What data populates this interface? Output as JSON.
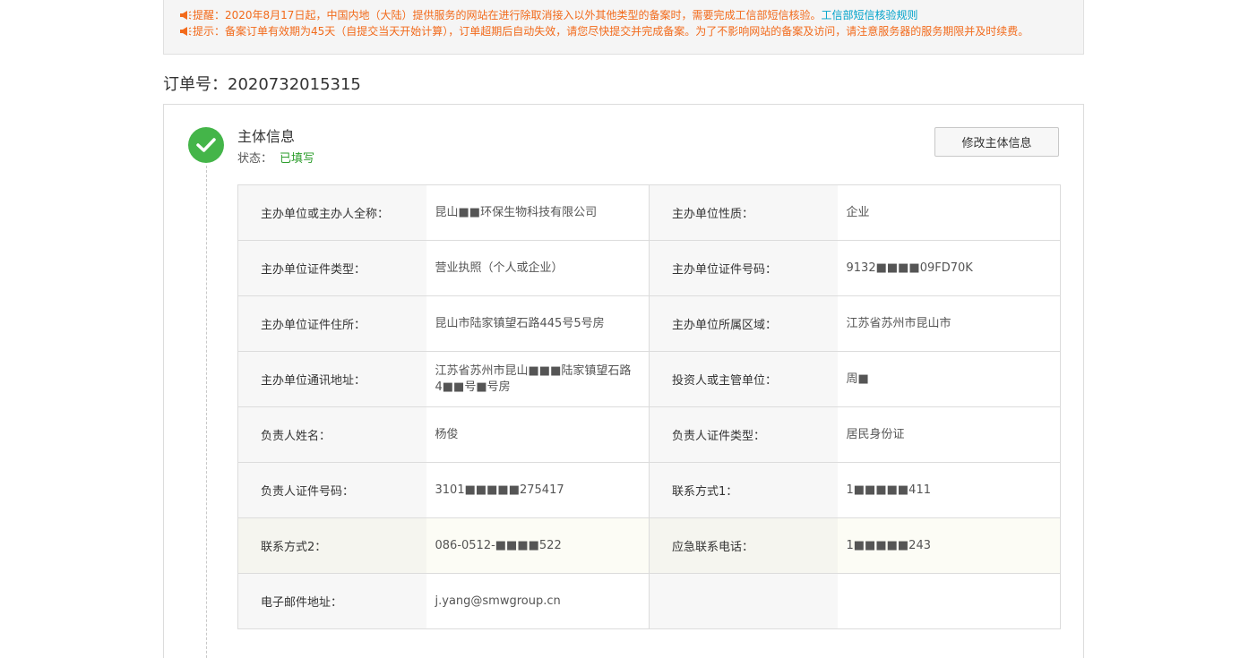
{
  "notice": {
    "line1": "提醒：2020年8月17日起，中国内地（大陆）提供服务的网站在进行除取消接入以外其他类型的备案时，需要完成工信部短信核验。",
    "line1_link": "工信部短信核验规则",
    "line2": "提示：备案订单有效期为45天（自提交当天开始计算），订单超期后自动失效，请您尽快提交并完成备案。为了不影响网站的备案及访问，请注意服务器的服务期限并及时续费。",
    "icon": "megaphone-icon",
    "color": "#f26a1b"
  },
  "order": {
    "label": "订单号：",
    "number": "2020732015315"
  },
  "section": {
    "title": "主体信息",
    "status_label": "状态：",
    "status_value": "已填写",
    "status_color": "#2e9e2e",
    "icon": "check-circle-icon",
    "edit_button": "修改主体信息"
  },
  "rows": [
    {
      "l1": "主办单位或主办人全称：",
      "v1": "昆山■■环保生物科技有限公司",
      "l2": "主办单位性质：",
      "v2": "企业"
    },
    {
      "l1": "主办单位证件类型：",
      "v1": "营业执照（个人或企业）",
      "l2": "主办单位证件号码：",
      "v2": "9132■■■■09FD70K"
    },
    {
      "l1": "主办单位证件住所：",
      "v1": "昆山市陆家镇望石路445号5号房",
      "l2": "主办单位所属区域：",
      "v2": "江苏省苏州市昆山市"
    },
    {
      "l1": "主办单位通讯地址：",
      "v1": "江苏省苏州市昆山■■■陆家镇望石路4■■号■号房",
      "l2": "投资人或主管单位：",
      "v2": "周■"
    },
    {
      "l1": "负责人姓名：",
      "v1": "杨俊",
      "l2": "负责人证件类型：",
      "v2": "居民身份证"
    },
    {
      "l1": "负责人证件号码：",
      "v1": "3101■■■■■275417",
      "l2": "联系方式1：",
      "v2": "1■■■■■411"
    },
    {
      "l1": "联系方式2：",
      "v1": "086-0512-■■■■522",
      "l2": "应急联系电话：",
      "v2": "1■■■■■243"
    },
    {
      "l1": "电子邮件地址：",
      "v1": "j.yang@smwgroup.cn",
      "l2": "",
      "v2": ""
    }
  ]
}
